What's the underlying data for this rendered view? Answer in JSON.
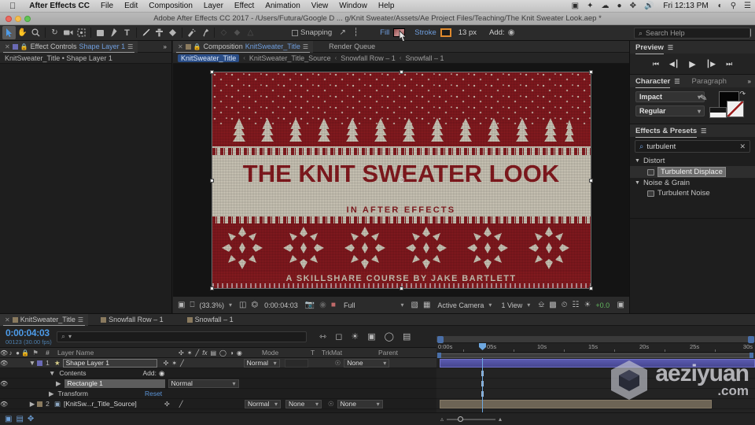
{
  "macmenu": {
    "apple_icon": "apple-icon",
    "app_name": "After Effects CC",
    "items": [
      "File",
      "Edit",
      "Composition",
      "Layer",
      "Effect",
      "Animation",
      "View",
      "Window",
      "Help"
    ],
    "status_icons": [
      "screen-record-icon",
      "dropbox-icon",
      "creative-cloud-icon",
      "drive-icon",
      "bluetooth-icon",
      "volume-icon"
    ],
    "clock": "Fri 12:13 PM",
    "right_icons": [
      "wifi-icon",
      "spotlight-search-icon",
      "notification-center-icon"
    ]
  },
  "window": {
    "title": "Adobe After Effects CC 2017 - /Users/Futura/Google D ... g/Knit Sweater/Assets/Ae Project Files/Teaching/The Knit Sweater Look.aep *"
  },
  "toolbar": {
    "tools": [
      {
        "name": "selection-tool",
        "glyph": "➤",
        "active": true
      },
      {
        "name": "hand-tool",
        "glyph": "✋",
        "active": false
      },
      {
        "name": "zoom-tool",
        "glyph": "⌕",
        "active": false
      },
      {
        "name": "rotation-tool",
        "glyph": "↺",
        "active": false
      },
      {
        "name": "camera-tool",
        "glyph": "📹",
        "active": false
      },
      {
        "name": "pan-behind-tool",
        "glyph": "⨁",
        "active": false
      },
      {
        "name": "shape-tool",
        "glyph": "■",
        "active": false
      },
      {
        "name": "pen-tool",
        "glyph": "✒",
        "active": false
      },
      {
        "name": "type-tool",
        "glyph": "T",
        "active": false
      },
      {
        "name": "brush-tool",
        "glyph": "╱",
        "active": false
      },
      {
        "name": "clone-stamp-tool",
        "glyph": "⚓",
        "active": false
      },
      {
        "name": "eraser-tool",
        "glyph": "◆",
        "active": false
      },
      {
        "name": "roto-brush-tool",
        "glyph": "✇",
        "active": false
      },
      {
        "name": "puppet-pin-tool",
        "glyph": "✦",
        "active": false
      }
    ],
    "snapping_label": "Snapping",
    "fill_label": "Fill",
    "stroke_label": "Stroke",
    "stroke_width": "13 px",
    "add_label": "Add:",
    "overflow_glyph": "»",
    "workspace_icon": "workspace-icon"
  },
  "search_help": {
    "placeholder": "Search Help",
    "icon": "search-icon"
  },
  "effect_controls": {
    "tab_label": "Effect Controls",
    "tab_layer": "Shape Layer 1",
    "subtitle": "KnitSweater_Title • Shape Layer 1",
    "menu_icon": "panel-menu-icon",
    "overflow_icon": "chevron-double-right-icon"
  },
  "composition": {
    "tab_label": "Composition",
    "tab_comp": "KnitSweater_Title",
    "render_queue_label": "Render Queue",
    "breadcrumbs": [
      "KnitSweater_Title",
      "KnitSweater_Title_Source",
      "Snowfall Row – 1",
      "Snowfall – 1"
    ],
    "artwork": {
      "title": "THE KNIT SWEATER LOOK",
      "subtitle": "IN AFTER EFFECTS",
      "footer": "A SKILLSHARE COURSE BY JAKE BARTLETT",
      "red": "#8e1c21",
      "cream": "#d8d2c2"
    },
    "bottom_bar": {
      "zoom": "(33.3%)",
      "timecode": "0:00:04:03",
      "resolution": "Full",
      "camera": "Active Camera",
      "views": "1 View",
      "exposure": "+0.0",
      "icons": [
        "main-view-icon",
        "monitor-icon",
        "title-safe-icon",
        "region-of-interest-icon",
        "snapshot-icon",
        "show-snapshot-icon",
        "channel-icon",
        "transparency-grid-icon",
        "mask-view-icon",
        "timeline-icon",
        "comp-flowchart-icon",
        "reset-exposure-icon"
      ]
    }
  },
  "preview": {
    "title": "Preview",
    "menu_icon": "panel-menu-icon",
    "buttons": [
      "first-frame-icon",
      "previous-frame-icon",
      "play-icon",
      "next-frame-icon",
      "last-frame-icon"
    ]
  },
  "character": {
    "tab_character": "Character",
    "tab_paragraph": "Paragraph",
    "menu_icon": "panel-menu-icon",
    "overflow_icon": "chevron-double-right-icon",
    "font_family": "Impact",
    "font_style": "Regular",
    "eyedropper_icon": "eyedropper-icon",
    "fill_swatch": "#050505",
    "stroke_swatch": "none",
    "swap_icon": "swap-colors-icon"
  },
  "effects_presets": {
    "title": "Effects & Presets",
    "menu_icon": "panel-menu-icon",
    "search_value": "turbulent",
    "search_icon": "search-icon",
    "clear_icon": "clear-x-icon",
    "groups": [
      {
        "name": "Distort",
        "items": [
          {
            "label": "Turbulent Displace",
            "selected": true
          }
        ]
      },
      {
        "name": "Noise & Grain",
        "items": [
          {
            "label": "Turbulent Noise",
            "selected": false
          }
        ]
      }
    ]
  },
  "timeline": {
    "tabs": [
      {
        "label": "KnitSweater_Title",
        "selected": true
      },
      {
        "label": "Snowfall Row – 1",
        "selected": false
      },
      {
        "label": "Snowfall – 1",
        "selected": false
      }
    ],
    "timecode": "0:00:04:03",
    "frames": "00123 (30.00 fps)",
    "search_icon": "search-icon",
    "header_icons": [
      "composition-mini-flowchart-icon",
      "draft-3d-icon",
      "hide-shy-layers-icon",
      "frame-blending-icon",
      "motion-blur-icon",
      "graph-editor-icon"
    ],
    "columns": [
      "#",
      "Layer Name",
      "Mode",
      "T",
      "TrkMat",
      "Parent"
    ],
    "switch_icons": [
      "audio-icon",
      "solo-icon",
      "lock-icon",
      "shy-icon",
      "collapse-icon",
      "quality-icon",
      "effects-icon",
      "frame-blend-icon",
      "motion-blur-icon",
      "adjustment-icon",
      "3d-icon"
    ],
    "rows": [
      {
        "index": "1",
        "name": "Shape Layer 1",
        "mode": "Normal",
        "trkmat": "",
        "parent": "None",
        "selected": true,
        "indent": 0,
        "type": "layer"
      },
      {
        "index": "",
        "name": "Contents",
        "mode": "",
        "add_label": "Add:",
        "parent": "",
        "selected": false,
        "indent": 1,
        "type": "group"
      },
      {
        "index": "",
        "name": "Rectangle 1",
        "mode": "Normal",
        "parent": "",
        "selected": false,
        "indent": 2,
        "type": "shape"
      },
      {
        "index": "",
        "name": "Transform",
        "mode": "Reset",
        "parent": "",
        "selected": false,
        "indent": 1,
        "type": "transform"
      },
      {
        "index": "2",
        "name": "[KnitSw...r_Title_Source]",
        "mode": "Normal",
        "trkmat": "None",
        "parent": "None",
        "selected": false,
        "indent": 0,
        "type": "layer"
      }
    ],
    "ruler_ticks": [
      "0:00s",
      "05s",
      "10s",
      "15s",
      "20s",
      "25s",
      "30s"
    ],
    "footer_icons": [
      "toggle-switches-modes-icon",
      "layer-switches-icon",
      "graph-editor-toggle-icon"
    ]
  },
  "watermark": {
    "main": "aeziyuan",
    "sub": ".com",
    "logo": "cube-logo-icon"
  }
}
